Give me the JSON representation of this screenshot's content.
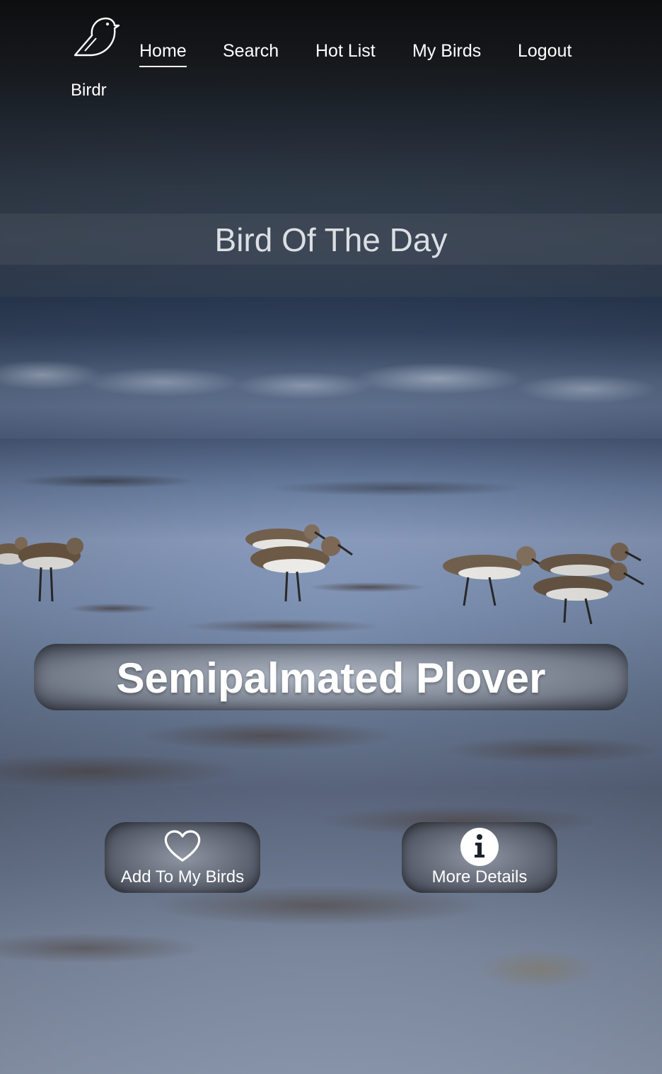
{
  "app": {
    "logo_text": "Birdr"
  },
  "nav": {
    "items": [
      {
        "label": "Home",
        "active": true
      },
      {
        "label": "Search",
        "active": false
      },
      {
        "label": "Hot List",
        "active": false
      },
      {
        "label": "My Birds",
        "active": false
      },
      {
        "label": "Logout",
        "active": false
      }
    ]
  },
  "main": {
    "section_title": "Bird Of The Day",
    "bird_name": "Semipalmated Plover",
    "actions": {
      "add_label": "Add To My Birds",
      "details_label": "More Details"
    }
  },
  "icons": {
    "logo": "bird-icon",
    "add": "heart-icon",
    "details": "info-icon"
  }
}
